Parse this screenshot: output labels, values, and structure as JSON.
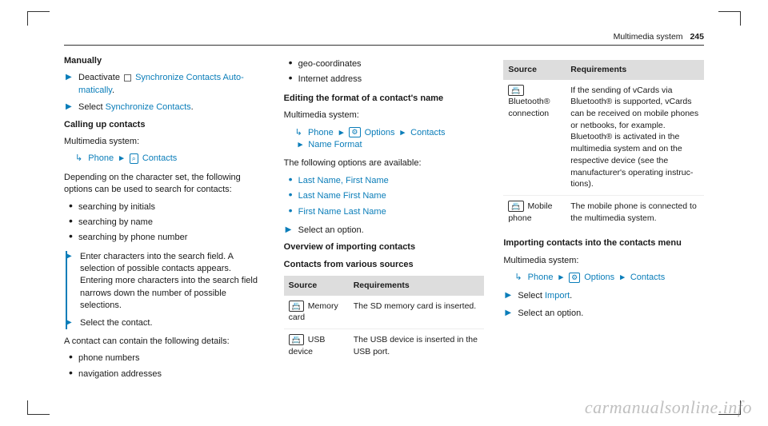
{
  "header": {
    "section": "Multimedia system",
    "page": "245"
  },
  "col1": {
    "h_manually": "Manually",
    "step_deactivate_pre": "Deactivate ",
    "step_deactivate_link": "Synchronize Contacts Auto­matically",
    "step_deactivate_post": ".",
    "step_select_pre": "Select ",
    "step_select_link": "Synchronize Contacts",
    "step_select_post": ".",
    "h_calling": "Calling up contacts",
    "mms": "Multimedia system:",
    "crumb_phone": "Phone",
    "crumb_contacts": "Contacts",
    "p_depending": "Depending on the character set, the following options can be used to search for contacts:",
    "li_initials": "searching by initials",
    "li_name": "searching by name",
    "li_phone": "searching by phone number",
    "step_enter": "Enter characters into the search field. A selection of possible contacts appears. Entering more characters into the search field narrows down the number of possible selections.",
    "step_selcontact": "Select the contact.",
    "p_details": "A contact can contain the following details:",
    "li_pn": "phone numbers",
    "li_na": "navigation addresses"
  },
  "col2": {
    "li_geo": "geo-coordinates",
    "li_inet": "Internet address",
    "h_editing": "Editing the format of a contact's name",
    "mms": "Multimedia system:",
    "crumb_phone": "Phone",
    "crumb_options": "Options",
    "crumb_contacts": "Contacts",
    "crumb_nameformat": "Name Format",
    "p_options": "The following options are available:",
    "li_lfc": "Last Name, First Name",
    "li_lf": "Last Name First Name",
    "li_fl": "First Name Last Name",
    "step_selopt": "Select an option.",
    "h_overview": "Overview of importing contacts",
    "h_cfvs": "Contacts from various sources",
    "table": {
      "th_source": "Source",
      "th_req": "Requirements",
      "rows": [
        {
          "icon": "📇",
          "src": " Memory card",
          "req": "The SD memory card is inserted."
        },
        {
          "icon": "📇",
          "src": " USB device",
          "req": "The USB device is inserted in the USB port."
        }
      ]
    }
  },
  "col3": {
    "table": {
      "th_source": "Source",
      "th_req": "Requirements",
      "rows": [
        {
          "icon": "📇",
          "src": " Bluetooth® con­nection",
          "req": "If the sending of vCards via Bluetooth® is supported, vCards can be received on mobile phones or net­books, for example.\nBluetooth® is activa­ted in the multimedia system and on the respective device (see the manufactur­er's operating instruc­tions)."
        },
        {
          "icon": "📇",
          "src": " Mobile phone",
          "req": "The mobile phone is connected to the mul­timedia system."
        }
      ]
    },
    "h_importing": "Importing contacts into the contacts menu",
    "mms": "Multimedia system:",
    "crumb_phone": "Phone",
    "crumb_options": "Options",
    "crumb_contacts": "Contacts",
    "step_import_pre": "Select ",
    "step_import_link": "Import",
    "step_import_post": ".",
    "step_selopt": "Select an option."
  },
  "watermark": "carmanualsonline.info"
}
